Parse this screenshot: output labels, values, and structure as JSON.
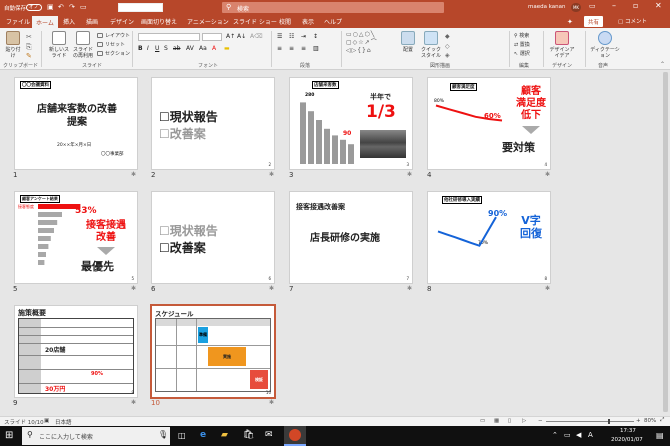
{
  "titlebar": {
    "autosave_label": "自動保存",
    "autosave_state": "オフ",
    "search_placeholder": "検索",
    "user_name": "maeda kanan",
    "avatar_initials": "MK"
  },
  "tabs": [
    "ファイル",
    "ホーム",
    "挿入",
    "描画",
    "デザイン",
    "画面切り替え",
    "アニメーション",
    "スライド ショー",
    "校閲",
    "表示",
    "ヘルプ"
  ],
  "tabs_right": {
    "share": "共有",
    "comments": "コメント"
  },
  "ribbon": {
    "groups": [
      "クリップボード",
      "スライド",
      "フォント",
      "段落",
      "図形描画",
      "編集",
      "デザイン",
      "音声"
    ],
    "paste": "貼り付け",
    "new_slide": "新しいスライド",
    "reuse_slide": "スライドの再利用",
    "layout": "レイアウト",
    "reset": "リセット",
    "section": "セクション",
    "shapes": "図形",
    "arrange": "配置",
    "quick_styles": "クイックスタイル",
    "find": "検索",
    "replace": "置換",
    "select": "選択",
    "designer": "デザインアイデア",
    "dictate": "ディクテーション"
  },
  "slides": [
    {
      "num": "1",
      "title_tag": "〇〇会議資料",
      "title": "店舗来客数の改善提案",
      "date": "20××年×月×日",
      "dept": "〇〇事業部"
    },
    {
      "num": "2",
      "item1": "☐現状報告",
      "item2": "☐改善案"
    },
    {
      "num": "3",
      "chart_title": "店舗来客数",
      "top_value": "280",
      "low_value": "90",
      "caption": "半年で",
      "fraction": "1/3"
    },
    {
      "num": "4",
      "chart_title": "顧客満足度",
      "start_value": "80%",
      "end_value": "60%",
      "red_line1": "顧客",
      "red_line2": "満足度",
      "red_line3": "低下",
      "black_text": "要対策"
    },
    {
      "num": "5",
      "chart_title": "顧客アンケート結果",
      "top_item": "接客態度",
      "percent": "53%",
      "red1": "接客接遇",
      "red2": "改善",
      "black": "最優先"
    },
    {
      "num": "6",
      "item1": "☐現状報告",
      "item2": "☐改善案"
    },
    {
      "num": "7",
      "title": "接客接遇改善案",
      "body": "店長研修の実施"
    },
    {
      "num": "8",
      "chart_title": "他社研修導入実績",
      "low_value": "70%",
      "high_value": "90%",
      "blue1": "V字",
      "blue2": "回復"
    },
    {
      "num": "9",
      "title": "施策概要",
      "highlight_value": "20店舗",
      "rate": "90%",
      "cost": "30万円"
    },
    {
      "num": "10",
      "title": "スケジュール",
      "bar_label1": "準備",
      "bar_label2": "実施",
      "bar_label3": "検証"
    }
  ],
  "chart_data": [
    {
      "type": "bar",
      "title": "店舗来客数",
      "values": [
        280,
        240,
        200,
        160,
        130,
        110,
        90
      ]
    },
    {
      "type": "line",
      "title": "顧客満足度",
      "values": [
        80,
        75,
        70,
        65,
        62,
        60
      ]
    },
    {
      "type": "bar",
      "title": "顧客アンケート結果",
      "values": [
        53,
        30,
        24,
        20,
        16,
        13,
        10,
        8
      ]
    },
    {
      "type": "line",
      "title": "他社研修導入実績",
      "values": [
        80,
        78,
        76,
        74,
        72,
        70,
        80,
        90
      ]
    }
  ],
  "status": {
    "slide_info": "スライド 10/10",
    "language": "日本語",
    "notes": "ノート",
    "zoom": "80%"
  },
  "taskbar": {
    "search_placeholder": "ここに入力して検索",
    "time": "17:37",
    "date": "2020/01/07"
  },
  "colors": {
    "accent": "#b7472a",
    "red": "#e11",
    "blue": "#1463d8",
    "orange": "#f0961e"
  }
}
